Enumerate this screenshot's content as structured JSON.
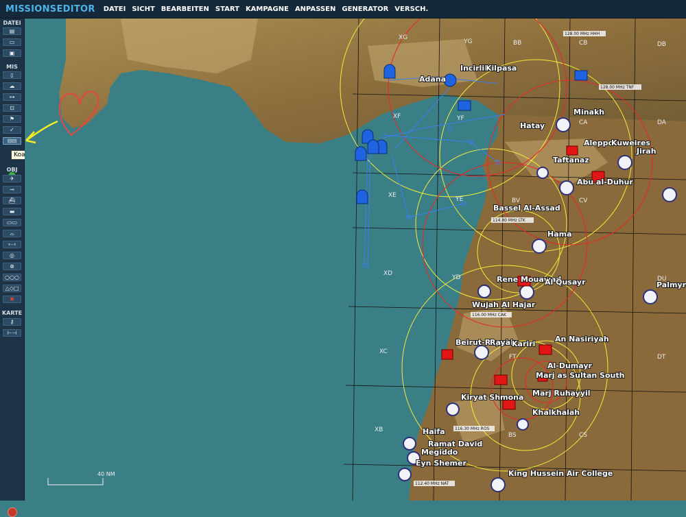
{
  "app": {
    "title": "MISSIONSEDITOR"
  },
  "menu": [
    "DATEI",
    "SICHT",
    "BEARBEITEN",
    "START",
    "KAMPAGNE",
    "ANPASSEN",
    "GENERATOR",
    "VERSCH."
  ],
  "sidebar": {
    "sections": {
      "datei": "DATEI",
      "mis": "MIS",
      "obj": "OBJ",
      "karte": "KARTE"
    },
    "tooltip": "Koalitionen wechseln"
  },
  "map": {
    "airbases": [
      {
        "name": "Incirlik"
      },
      {
        "name": "Adana"
      },
      {
        "name": "Kilpasa"
      },
      {
        "name": "Hatay"
      },
      {
        "name": "Minakh"
      },
      {
        "name": "Aleppo"
      },
      {
        "name": "Kuweires"
      },
      {
        "name": "Jirah"
      },
      {
        "name": "Taftanaz"
      },
      {
        "name": "Abu al-Duhur"
      },
      {
        "name": "Bassel Al-Assad"
      },
      {
        "name": "Hama"
      },
      {
        "name": "Rene Mouawad"
      },
      {
        "name": "Al Qusayr"
      },
      {
        "name": "Wujah Al Hajar"
      },
      {
        "name": "Beirut-Rayak"
      },
      {
        "name": "Rayak"
      },
      {
        "name": "Kariri"
      },
      {
        "name": "An Nasiriyah"
      },
      {
        "name": "Al-Dumayr"
      },
      {
        "name": "Marj as Sultan South"
      },
      {
        "name": "Marj Ruhayyil"
      },
      {
        "name": "Kiryat Shmona"
      },
      {
        "name": "Khalkhalah"
      },
      {
        "name": "Haifa"
      },
      {
        "name": "Ramat David"
      },
      {
        "name": "Megiddo"
      },
      {
        "name": "Eyn Shemer"
      },
      {
        "name": "King Hussein Air College"
      },
      {
        "name": "Palmyra"
      }
    ],
    "grid_labels": [
      "XG",
      "YG",
      "BB",
      "CB",
      "DB",
      "XF",
      "YF",
      "CA",
      "DA",
      "YE",
      "XE",
      "BV",
      "CV",
      "XD",
      "YD",
      "DU",
      "XC",
      "FT",
      "DT",
      "XB",
      "BS",
      "CS"
    ],
    "frequency_labels": [
      "128.00 MHz HHH",
      "128.00 MHz TNF",
      "116.30 MHz ROS",
      "112.40 MHz NAT",
      "114.80 MHz LTK",
      "116.00 MHz CAK"
    ],
    "scale": "40 NM"
  },
  "colors": {
    "sea": "#3b7f86",
    "topbar": "#16293b",
    "sidebar": "#1d3448",
    "title_accent": "#4db3e6",
    "blue_coalition": "#1f63e0",
    "red_coalition": "#e31616",
    "range_ring_yellow": "#f2ec3a",
    "range_ring_red": "#e32a2a"
  }
}
